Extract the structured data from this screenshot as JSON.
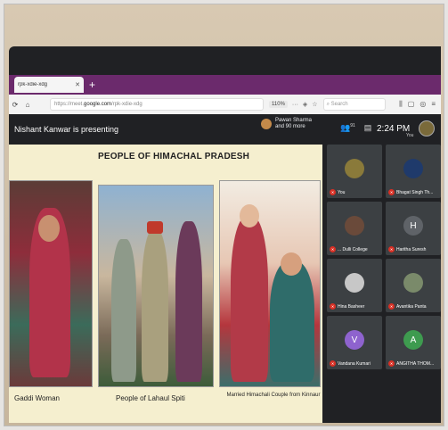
{
  "browser": {
    "tab_title": "rpk-xdie-xdg",
    "tab_close": "✕",
    "new_tab": "+",
    "url_prefix": "https://meet.",
    "url_domain": "google.com",
    "url_suffix": "/rpk-xdie-xdg",
    "zoom": "110%",
    "search_placeholder": "Search"
  },
  "meet": {
    "presenting_text": "Nishant Kanwar is presenting",
    "people_line1": "Pawan Sharma",
    "people_line2": "and 90 more",
    "people_count": "91",
    "time": "2:24 PM",
    "you_label": "You"
  },
  "slide": {
    "title": "PEOPLE OF HIMACHAL PRADESH",
    "captions": [
      "Gaddi Woman",
      "People of Lahaul Spiti",
      "Married Himachali Couple from Kinnaur"
    ]
  },
  "participants": [
    {
      "name": "You",
      "initial": "",
      "color": "#8a7a3a"
    },
    {
      "name": "Bhagat Singh Th...",
      "initial": "",
      "color": "#1f3a6b"
    },
    {
      "name": "... Dulli College",
      "initial": "",
      "color": "#6a4a3a"
    },
    {
      "name": "Haritha Suresh",
      "initial": "H",
      "color": "#5f6368"
    },
    {
      "name": "Hina Basheer",
      "initial": "",
      "color": "#c7c7c7"
    },
    {
      "name": "Avantika Panta",
      "initial": "",
      "color": "#7a8a6a"
    },
    {
      "name": "Vandana Kumari",
      "initial": "V",
      "color": "#8e63ce"
    },
    {
      "name": "ANGITHA THOM...",
      "initial": "A",
      "color": "#3e9b4f"
    }
  ]
}
